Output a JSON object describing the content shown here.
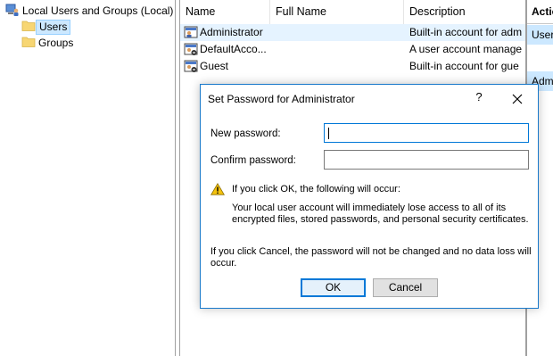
{
  "tree": {
    "root_label": "Local Users and Groups (Local)",
    "items": [
      {
        "label": "Users",
        "selected": true
      },
      {
        "label": "Groups",
        "selected": false
      }
    ]
  },
  "list": {
    "columns": [
      "Name",
      "Full Name",
      "Description"
    ],
    "rows": [
      {
        "name": "Administrator",
        "full_name": "",
        "description": "Built-in account for adm",
        "selected": true
      },
      {
        "name": "DefaultAcco...",
        "full_name": "",
        "description": "A user account manage",
        "selected": false
      },
      {
        "name": "Guest",
        "full_name": "",
        "description": "Built-in account for gue",
        "selected": false
      }
    ]
  },
  "actions": {
    "header": "Actio",
    "items": [
      "User",
      "Adm"
    ]
  },
  "dialog": {
    "title": "Set Password for Administrator",
    "help": "?",
    "new_password_label": "New password:",
    "new_password_value": "",
    "confirm_password_label": "Confirm password:",
    "confirm_password_value": "",
    "warning_heading": "If you click OK, the following will occur:",
    "warning_line1": "Your local user account will immediately lose access to all of its",
    "warning_line2": "encrypted files, stored passwords, and personal security certificates.",
    "cancel_note_line1": "If you click Cancel, the password will not be changed and no data loss will",
    "cancel_note_line2": "occur.",
    "ok_label": "OK",
    "cancel_label": "Cancel"
  },
  "colors": {
    "accent": "#0078d7",
    "selection": "#cce8ff",
    "warning": "#f4c20d"
  },
  "icons": {
    "computer": "computer-management-icon",
    "folder": "folder-icon",
    "user": "user-account-icon",
    "warning": "warning-icon",
    "close": "close-icon"
  }
}
